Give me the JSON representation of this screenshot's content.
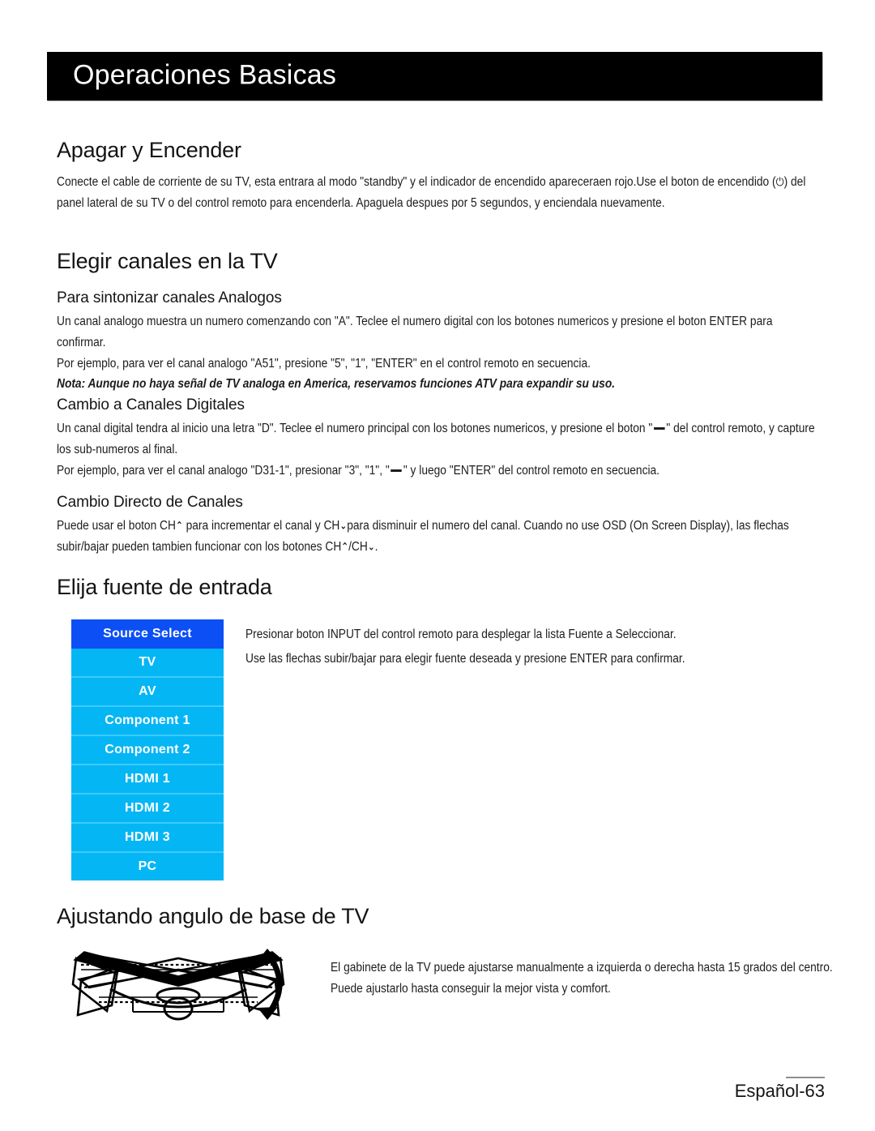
{
  "banner": {
    "title": "Operaciones Basicas"
  },
  "sections": {
    "power": {
      "heading": "Apagar y Encender",
      "body_pre": "Conecte el cable de corriente de su TV, esta entrara al modo \"standby\" y el indicador de encendido apareceraen  rojo.Use el boton de encendido (",
      "power_icon": "⏻",
      "body_post": ") del panel lateral de su TV o del control remoto para encenderla. Apaguela despues por 5 segundos, y enciendala nuevamente."
    },
    "channels": {
      "heading": "Elegir canales en la TV",
      "analog": {
        "subheading": "Para sintonizar canales Analogos",
        "p1": "Un canal analogo muestra un numero comenzando con \"A\". Teclee el numero digital con los botones numericos y presione el boton ENTER para confirmar.",
        "p2": "Por ejemplo, para ver el canal analogo \"A51\", presione \"5\", \"1\", \"ENTER\" en el control remoto en secuencia.",
        "note": "Nota: Aunque no haya señal de TV analoga en America, reservamos funciones ATV para expandir su uso."
      },
      "digital": {
        "subheading": "Cambio a Canales Digitales",
        "p1_pre": "Un canal digital tendra al inicio una letra \"D\". Teclee el numero principal con los botones numericos, y presione el boton \"",
        "p1_post": "\" del control remoto, y capture los sub-numeros al final.",
        "p2_pre": "Por ejemplo, para ver el canal  analogo \"D31-1\", presionar \"3\", \"1\", \"",
        "p2_post": "\" y luego \"ENTER\" del control remoto en secuencia."
      },
      "direct": {
        "subheading": "Cambio Directo de Canales",
        "p1_a": "Puede usar el boton CH",
        "chev_up": "⌃",
        "p1_b": " para incrementar el canal y CH",
        "chev_down": "⌄",
        "p1_c": "para disminuir el numero del canal. Cuando no use OSD (On Screen Display), las flechas subir/bajar pueden tambien funcionar con los botones CH",
        "p1_d": "/CH",
        "p1_e": "."
      }
    },
    "input_source": {
      "heading": "Elija fuente de entrada",
      "p1": "Presionar boton INPUT del control remoto para desplegar la lista Fuente a Seleccionar.",
      "p2": "Use las flechas subir/bajar para elegir fuente deseada y presione ENTER para confirmar."
    },
    "stand_angle": {
      "heading": "Ajustando angulo de base de TV",
      "p1": "El gabinete de la TV puede ajustarse manualmente a izquierda o derecha hasta 15 grados del centro. Puede ajustarlo hasta conseguir la mejor vista y comfort."
    }
  },
  "source_select": {
    "header_label": "Source Select",
    "header_color": "#0b4ff5",
    "item_color": "#05b6f5",
    "separator_color": "#3ccbfb",
    "items": [
      {
        "label": "TV"
      },
      {
        "label": "AV"
      },
      {
        "label": "Component 1"
      },
      {
        "label": "Component 2"
      },
      {
        "label": "HDMI 1"
      },
      {
        "label": "HDMI 2"
      },
      {
        "label": "HDMI 3"
      },
      {
        "label": "PC"
      }
    ]
  },
  "footer": {
    "page_label": "Español-63"
  }
}
